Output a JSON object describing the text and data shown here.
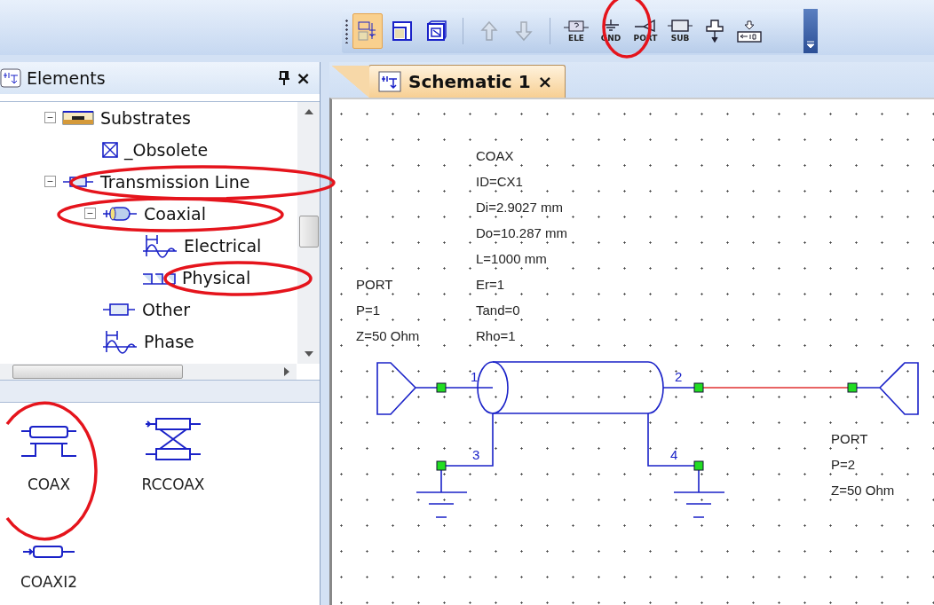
{
  "toolbar": {
    "items": [
      {
        "kind": "layout",
        "selected": true,
        "disabled": false
      },
      {
        "kind": "window",
        "selected": false,
        "disabled": false
      },
      {
        "kind": "view3d",
        "selected": false,
        "disabled": false
      },
      {
        "kind": "separator"
      },
      {
        "kind": "up",
        "selected": false,
        "disabled": true
      },
      {
        "kind": "down",
        "selected": false,
        "disabled": true
      },
      {
        "kind": "separator"
      },
      {
        "kind": "element",
        "label": "ELE",
        "selected": false,
        "disabled": false
      },
      {
        "kind": "ground",
        "label": "GND",
        "selected": false,
        "disabled": false
      },
      {
        "kind": "port",
        "label": "PORT",
        "selected": false,
        "disabled": false
      },
      {
        "kind": "subcircuit",
        "label": "SUB",
        "selected": false,
        "disabled": false
      },
      {
        "kind": "probe",
        "selected": false,
        "disabled": false
      },
      {
        "kind": "scale",
        "selected": false,
        "disabled": false
      }
    ]
  },
  "elements_panel": {
    "title": "Elements",
    "close": "×",
    "tree": [
      {
        "label": "Substrates",
        "kind": "substrate",
        "expanded": true,
        "children": [
          {
            "label": "_Obsolete",
            "kind": "obsolete"
          }
        ]
      },
      {
        "label": "Transmission Line",
        "kind": "line",
        "expanded": true,
        "children": [
          {
            "label": "Coaxial",
            "kind": "coax",
            "expanded": true,
            "children": [
              {
                "label": "Electrical",
                "kind": "wave"
              },
              {
                "label": "Physical",
                "kind": "physical"
              }
            ]
          },
          {
            "label": "Other",
            "kind": "box"
          },
          {
            "label": "Phase",
            "kind": "wave"
          }
        ]
      }
    ],
    "palette": [
      {
        "label": "COAX",
        "kind": "coax"
      },
      {
        "label": "RCCOAX",
        "kind": "rccoax"
      },
      {
        "label": "COAXI2",
        "kind": "coaxi2"
      }
    ]
  },
  "tabs": [
    {
      "label": "Schematic 1",
      "close": "×",
      "selected": true
    }
  ],
  "schematic": {
    "coax_params": [
      "COAX",
      "ID=CX1",
      "Di=2.9027 mm",
      "Do=10.287 mm",
      "L=1000 mm",
      "Er=1",
      "Tand=0",
      "Rho=1"
    ],
    "port1_params": [
      "PORT",
      "P=1",
      "Z=50 Ohm"
    ],
    "port2_params": [
      "PORT",
      "P=2",
      "Z=50 Ohm"
    ],
    "pin_numbers": [
      "1",
      "2",
      "3",
      "4"
    ]
  }
}
